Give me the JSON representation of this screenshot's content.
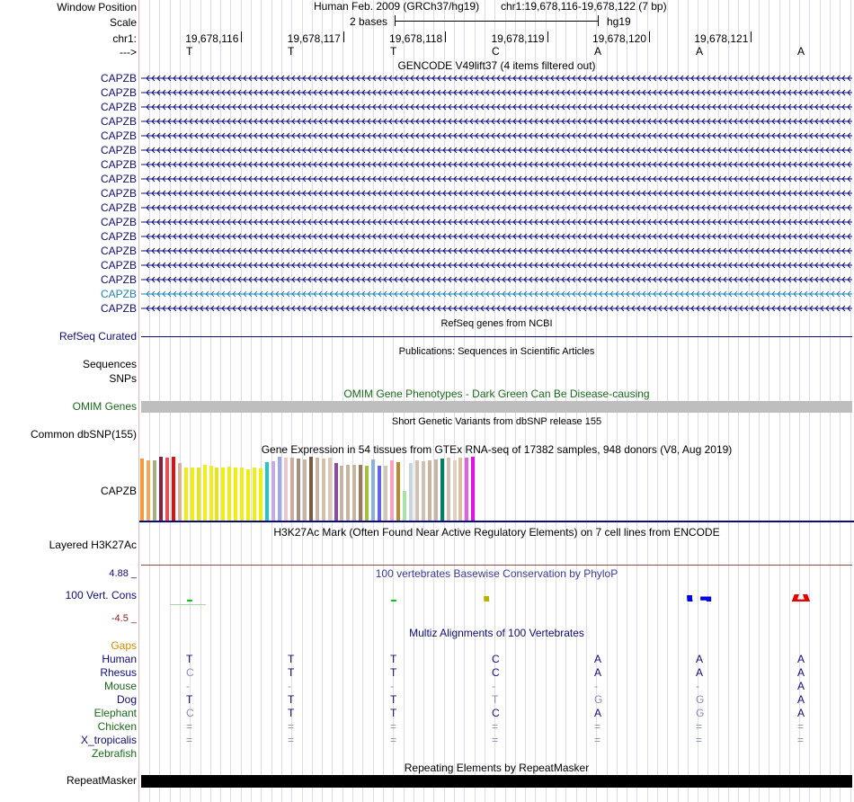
{
  "header": {
    "window_position_label": "Window Position",
    "scale_label": "Scale",
    "chrom_label": "chr1:",
    "arrow_label": "--->",
    "assembly": "Human Feb. 2009 (GRCh37/hg19)",
    "position": "chr1:19,678,116-19,678,122 (7 bp)",
    "scale_text": "2 bases",
    "scale_db": "hg19",
    "coordinates": [
      "19,678,116",
      "19,678,117",
      "19,678,118",
      "19,678,119",
      "19,678,120",
      "19,678,121"
    ],
    "bases": [
      "T",
      "T",
      "T",
      "C",
      "A",
      "A",
      "A"
    ]
  },
  "gencode": {
    "title": "GENCODE V49lift37 (4 items filtered out)",
    "gene_name": "CAPZB",
    "row_count": 17,
    "highlight_row": 15,
    "colors": {
      "normal": "#0c0c78",
      "highlight": "#1e82b4"
    }
  },
  "refseq": {
    "title": "RefSeq genes from NCBI",
    "label": "RefSeq Curated"
  },
  "publications": {
    "title": "Publications: Sequences in Scientific Articles",
    "labels": [
      "Sequences",
      "SNPs"
    ]
  },
  "omim": {
    "title": "OMIM Gene Phenotypes - Dark Green Can Be Disease-causing",
    "label": "OMIM Genes"
  },
  "dbsnp": {
    "title": "Short Genetic Variants from dbSNP release 155",
    "label": "Common dbSNP(155)"
  },
  "gtex": {
    "title": "Gene Expression in 54 tissues from GTEx RNA-seq of 17382 samples, 948 donors (V8, Aug 2019)",
    "label": "CAPZB",
    "values": [
      0.97,
      0.95,
      0.94,
      1.0,
      0.98,
      1.0,
      0.9,
      0.83,
      0.83,
      0.83,
      0.87,
      0.86,
      0.83,
      0.83,
      0.85,
      0.83,
      0.83,
      0.8,
      0.83,
      0.81,
      0.92,
      0.93,
      1.0,
      0.99,
      0.99,
      0.97,
      0.96,
      1.0,
      0.99,
      0.97,
      0.98,
      0.9,
      0.86,
      0.87,
      0.87,
      0.87,
      0.86,
      0.96,
      0.86,
      0.86,
      0.94,
      0.92,
      0.46,
      0.9,
      0.95,
      0.93,
      0.95,
      0.96,
      0.97,
      0.99,
      0.94,
      0.98,
      0.98,
      1.0
    ],
    "colors": [
      "#f59a3b",
      "#f5a84f",
      "#a0b480",
      "#8a2040",
      "#e85050",
      "#e01010",
      "#d2b49c",
      "#eeee10",
      "#eeee10",
      "#e6e610",
      "#eeee20",
      "#eeee20",
      "#e6e610",
      "#eeee10",
      "#eeee10",
      "#eeee10",
      "#eeee10",
      "#eeee10",
      "#eeee10",
      "#eeee10",
      "#22c8c8",
      "#c8aae6",
      "#a0a8e8",
      "#e8c8c8",
      "#d2aa9c",
      "#a09080",
      "#c8b4a0",
      "#7a5a40",
      "#c8b4a0",
      "#d2c0a8",
      "#e0c8b4",
      "#8a4aa0",
      "#c8b4a0",
      "#c8b4a0",
      "#c8b4a0",
      "#9a7a5a",
      "#a0c040",
      "#8ab0e0",
      "#6464e6",
      "#d2c8b4",
      "#f4a4c0",
      "#ba8a30",
      "#a8e0a8",
      "#c8d4e0",
      "#d2c0b4",
      "#d2c0b4",
      "#c8b4a0",
      "#c8b4a0",
      "#008060",
      "#d2c0b4",
      "#e0d0c0",
      "#dcc0a0",
      "#e060e0",
      "#e010e0"
    ]
  },
  "h3k27ac": {
    "title": "H3K27Ac Mark (Often Found Near Active Regulatory Elements) on 7 cell lines from ENCODE",
    "label": "Layered H3K27Ac"
  },
  "phylop": {
    "title": "100 vertebrates Basewise Conservation by PhyloP",
    "label": "100 Vert. Cons",
    "ymax": "4.88 _",
    "ymin": "-4.5 _",
    "logo": {
      "positions": [
        1,
        3,
        4,
        6,
        7
      ],
      "letters": [
        "T",
        "T",
        "C",
        "G",
        "A"
      ],
      "heights": [
        0.02,
        0.01,
        0.1,
        0.12,
        0.14
      ],
      "colors": [
        "#00c800",
        "#00c800",
        "#b4b400",
        "#0000e6",
        "#e60000"
      ]
    }
  },
  "multiz": {
    "title": "Multiz Alignments of 100 Vertebrates",
    "gaps_label": "Gaps",
    "species": [
      {
        "name": "Human",
        "color": "#0c0c78",
        "bases": [
          "T",
          "T",
          "T",
          "C",
          "A",
          "A",
          "A"
        ],
        "faded": [
          false,
          false,
          false,
          false,
          false,
          false,
          false
        ]
      },
      {
        "name": "Rhesus",
        "color": "#0c0c78",
        "bases": [
          "C",
          "T",
          "T",
          "C",
          "A",
          "A",
          "A"
        ],
        "faded": [
          true,
          false,
          false,
          false,
          false,
          false,
          false
        ]
      },
      {
        "name": "Mouse",
        "color": "#1a6a1a",
        "bases": [
          "-",
          "-",
          "-",
          "-",
          "-",
          "-",
          "A"
        ],
        "faded": [
          true,
          true,
          true,
          true,
          true,
          true,
          false
        ]
      },
      {
        "name": "Dog",
        "color": "#0c0c78",
        "bases": [
          "T",
          "T",
          "T",
          "T",
          "G",
          "G",
          "A"
        ],
        "faded": [
          false,
          false,
          false,
          true,
          true,
          true,
          false
        ]
      },
      {
        "name": "Elephant",
        "color": "#1a6a1a",
        "bases": [
          "C",
          "T",
          "T",
          "C",
          "A",
          "G",
          "A"
        ],
        "faded": [
          true,
          false,
          false,
          false,
          false,
          true,
          false
        ]
      },
      {
        "name": "Chicken",
        "color": "#1a6a1a",
        "bases": [
          "=",
          "=",
          "=",
          "=",
          "=",
          "=",
          "="
        ],
        "faded": [
          true,
          true,
          true,
          true,
          true,
          true,
          true
        ]
      },
      {
        "name": "X_tropicalis",
        "color": "#0c0c78",
        "bases": [
          "=",
          "=",
          "=",
          "=",
          "=",
          "=",
          "="
        ],
        "faded": [
          true,
          true,
          true,
          true,
          true,
          true,
          true
        ]
      },
      {
        "name": "Zebrafish",
        "color": "#1a6a1a",
        "bases": [
          "",
          "",
          "",
          "",
          "",
          "",
          ""
        ],
        "faded": [
          false,
          false,
          false,
          false,
          false,
          false,
          false
        ]
      }
    ]
  },
  "repeatmasker": {
    "title": "Repeating Elements by RepeatMasker",
    "label": "RepeatMasker"
  }
}
